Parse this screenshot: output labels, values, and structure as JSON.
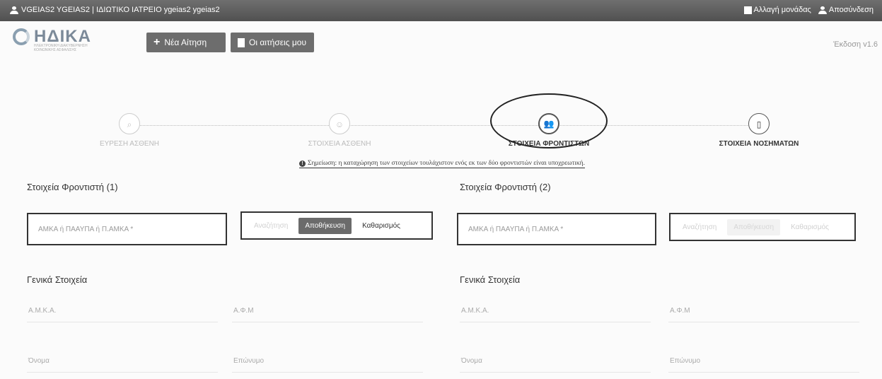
{
  "topbar": {
    "user_text": "VGEIAS2 YGEIAS2 | ΙΔΙΩΤΙΚΟ ΙΑΤΡΕΙΟ ygeias2 ygeias2",
    "change_unit": "Αλλαγή μονάδας",
    "logout": "Αποσύνδεση"
  },
  "header": {
    "logo": "ΗΔΙΚΑ",
    "logo_sub": "ΗΛΕΚΤΡΟΝΙΚΗ ΔΙΑΚΥΒΕΡΝΗΣΗ ΚΟΙΝΩΝΙΚΗΣ ΑΣΦΑΛΙΣΗΣ",
    "new_request": "Νέα Αίτηση",
    "my_requests": "Οι αιτήσεις μου",
    "version": "Έκδοση v1.6"
  },
  "steps": [
    {
      "label": "ΕΥΡΕΣΗ ΑΣΘΕΝΗ",
      "icon": "search-icon",
      "glyph": "⌕"
    },
    {
      "label": "ΣΤΟΙΧΕΙΑ ΑΣΘΕΝΗ",
      "icon": "person-icon",
      "glyph": "☺"
    },
    {
      "label": "ΣΤΟΙΧΕΙΑ ΦΡΟΝΤΙΣΤΩΝ",
      "icon": "people-icon",
      "glyph": "👥"
    },
    {
      "label": "ΣΤΟΙΧΕΙΑ ΝΟΣΗΜΑΤΩΝ",
      "icon": "clipboard-icon",
      "glyph": "▯"
    }
  ],
  "note": "Σημείωση: η καταχώρηση των στοιχείων τουλάχιστον ενός εκ των δύο φροντιστών είναι υποχρεωτική.",
  "carer1": {
    "title": "Στοιχεία Φροντιστή (1)",
    "placeholder": "ΑΜΚΑ ή ΠΑΑΥΠΑ ή Π.ΑΜΚΑ *",
    "search": "Αναζήτηση",
    "save": "Αποθήκευση",
    "clear": "Καθαρισμός",
    "general": "Γενικά Στοιχεία",
    "amka": "Α.Μ.Κ.Α.",
    "afm": "Α.Φ.Μ",
    "name": "Όνομα",
    "surname": "Επώνυμο"
  },
  "carer2": {
    "title": "Στοιχεία Φροντιστή (2)",
    "placeholder": "ΑΜΚΑ ή ΠΑΑΥΠΑ ή Π.ΑΜΚΑ *",
    "search": "Αναζήτηση",
    "save": "Αποθήκευση",
    "clear": "Καθαρισμός",
    "general": "Γενικά Στοιχεία",
    "amka": "Α.Μ.Κ.Α.",
    "afm": "Α.Φ.Μ",
    "name": "Όνομα",
    "surname": "Επώνυμο"
  }
}
